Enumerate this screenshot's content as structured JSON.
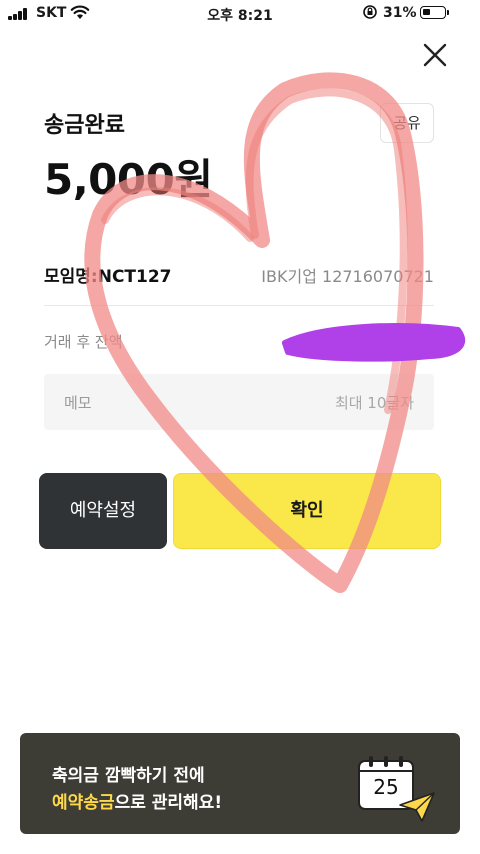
{
  "status_bar": {
    "carrier": "SKT",
    "time": "오후 8:21",
    "battery_percent": "31%",
    "battery_level": 0.31
  },
  "header": {
    "close_icon": "close-icon"
  },
  "transfer": {
    "title": "송금완료",
    "share_label": "공유",
    "amount": "5,000원"
  },
  "recipient": {
    "label": "모임명:NCT127",
    "account": "IBK기업 12716070721"
  },
  "balance": {
    "label": "거래 후 잔액"
  },
  "memo": {
    "label": "메모",
    "value": "",
    "placeholder": "최대 10글자"
  },
  "actions": {
    "schedule_label": "예약설정",
    "confirm_label": "확인"
  },
  "banner": {
    "line1": "축의금 깜빡하기 전에",
    "line2_highlight": "예약송금",
    "line2_rest": "으로 관리해요!",
    "calendar_day": "25",
    "highlight_color": "#ffd84a"
  },
  "colors": {
    "confirm_button": "#fae74a",
    "schedule_button": "#2f3336",
    "banner_bg": "#3d3d36",
    "scribble_heart": "#f08a86",
    "redaction": "#b040e8"
  }
}
